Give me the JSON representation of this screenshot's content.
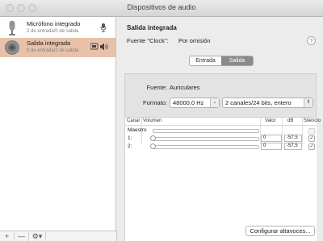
{
  "window": {
    "title": "Dispositivos de audio"
  },
  "devices": [
    {
      "name": "Micrófono integrado",
      "sub": "2 de entrada/0 de salida",
      "icon": "microphone-icon",
      "selected": false
    },
    {
      "name": "Salida integrada",
      "sub": "0 de entrada/2 de salida",
      "icon": "speaker-icon",
      "selected": true
    }
  ],
  "sidebar_footer": {
    "add": "+",
    "remove": "—",
    "gear": "⚙▾"
  },
  "detail": {
    "title": "Salida integrada",
    "clock_label": "Fuente \"Clock\":",
    "clock_value": "Por omisión",
    "help": "?"
  },
  "tabs": [
    {
      "label": "Entrada",
      "active": false
    },
    {
      "label": "Salida",
      "active": true
    }
  ],
  "format": {
    "source_label": "Fuente:",
    "source_value": "Auriculares",
    "format_label": "Formato:",
    "rate": "48000,0 Hz",
    "channels": "2 canales/24 bits, entero"
  },
  "table": {
    "headers": {
      "canal": "Canal",
      "volumen": "Volumen",
      "valor": "Valor",
      "db": "dB",
      "silencio": "Silencio"
    },
    "rows": [
      {
        "label": "Maestro",
        "valor": "",
        "db": "",
        "mute": false,
        "checkbox_enabled": false
      },
      {
        "label": "1:",
        "valor": "0",
        "db": "-57,5",
        "mute": true,
        "checkbox_enabled": true
      },
      {
        "label": "2:",
        "valor": "0",
        "db": "-57,5",
        "mute": true,
        "checkbox_enabled": true
      }
    ]
  },
  "configure_button": "Configurar altavoces..."
}
